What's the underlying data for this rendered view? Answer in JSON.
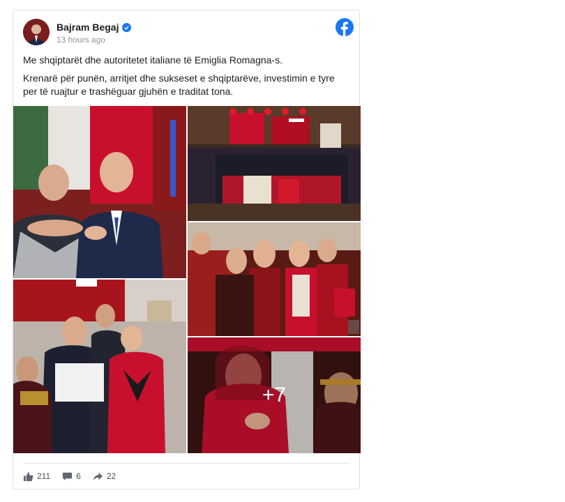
{
  "post": {
    "author": "Bajram Begaj",
    "timestamp": "13 hours ago",
    "paragraphs": [
      "Me shqiptarët dhe autoritetet italiane të Emiglia Romagna-s.",
      "Krenarë për punën, arritjet dhe sukseset e shqiptarëve, investimin e tyre per të ruajtur e trashëguar gjuhën e traditat tona."
    ],
    "more_photos": "+7"
  },
  "stats": {
    "likes": "211",
    "comments": "6",
    "shares": "22"
  },
  "colors": {
    "brand": "#1877f2",
    "flag_red": "#c8102e",
    "muted_text": "#90949c"
  },
  "icons": {
    "verified": "verified-badge-icon",
    "platform": "facebook-logo-icon",
    "like": "thumbs-up-icon",
    "comment": "comment-icon",
    "share": "share-arrow-icon"
  }
}
